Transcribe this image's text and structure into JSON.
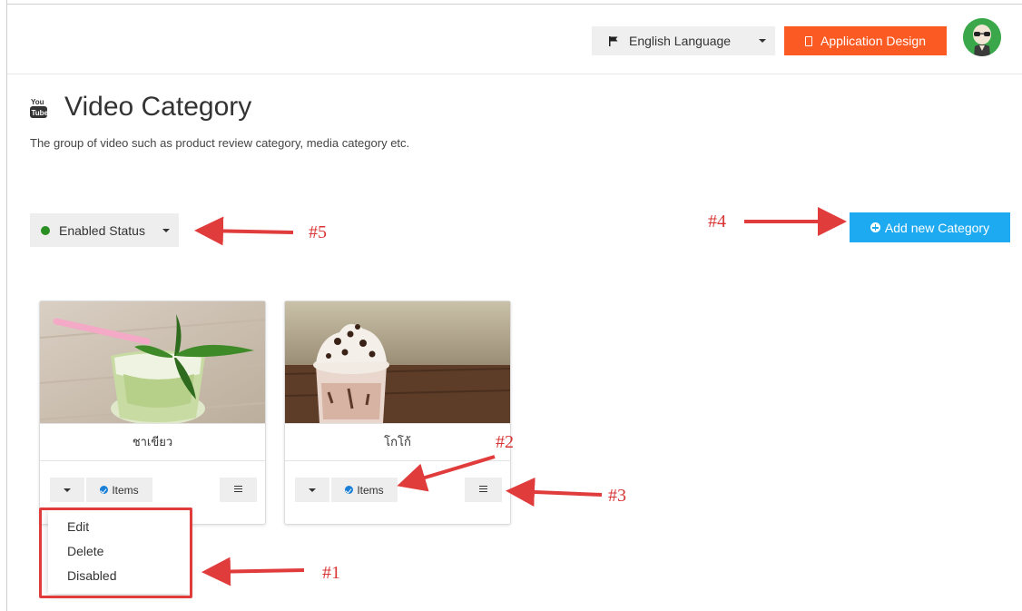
{
  "topbar": {
    "language_label": "English Language",
    "app_design_label": "Application Design"
  },
  "header": {
    "title": "Video Category",
    "subtitle": "The group of video such as product review category, media category etc.",
    "icon": "youtube-icon"
  },
  "filter": {
    "status_label": "Enabled Status",
    "status_color": "#2a8f22"
  },
  "actions": {
    "add_label": "Add new Category",
    "add_color": "#1eaaf1"
  },
  "cards": [
    {
      "name": "ชาเขียว",
      "items_label": "Items"
    },
    {
      "name": "โกโก้",
      "items_label": "Items"
    }
  ],
  "dropdown": {
    "items": [
      "Edit",
      "Delete",
      "Disabled"
    ]
  },
  "annotations": {
    "a1": "#1",
    "a2": "#2",
    "a3": "#3",
    "a4": "#4",
    "a5": "#5"
  },
  "colors": {
    "accent_orange": "#fb5a22",
    "annotation_red": "#d83434"
  }
}
